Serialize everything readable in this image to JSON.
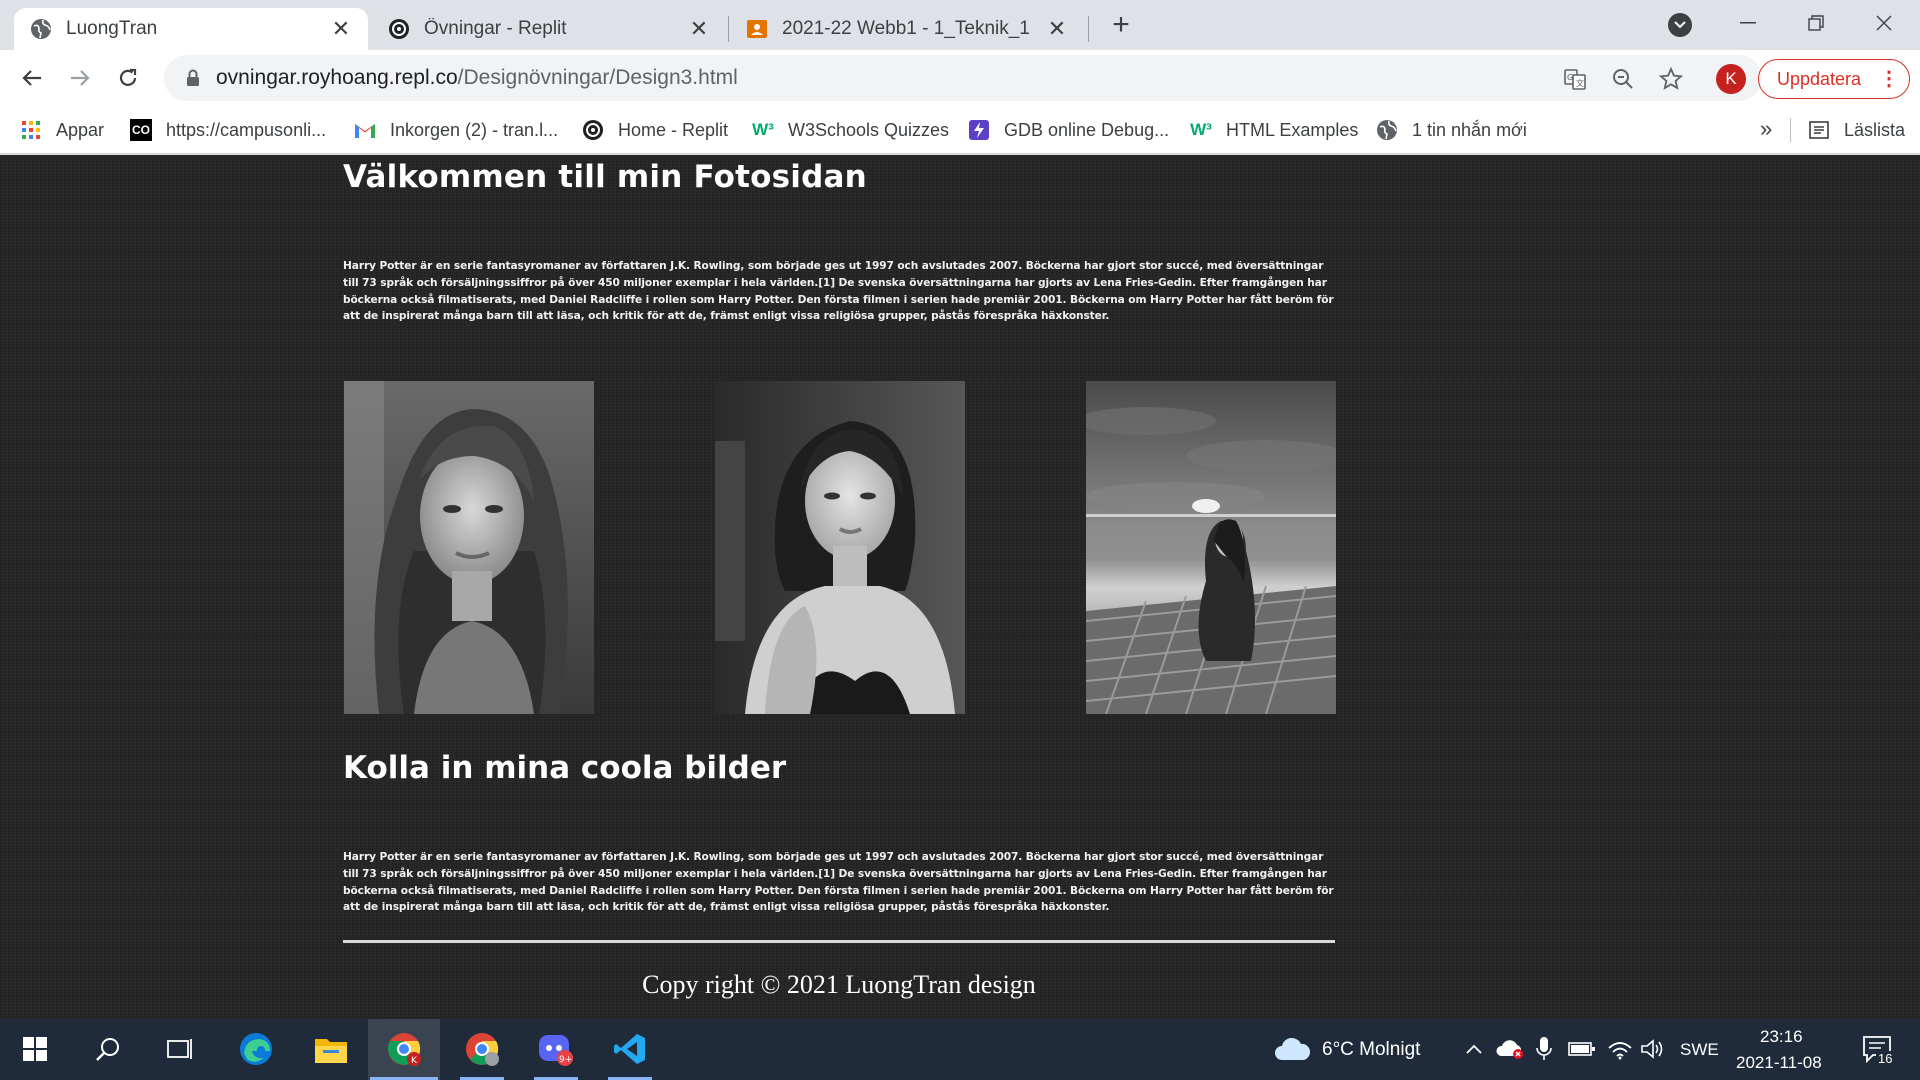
{
  "browser": {
    "tabs": [
      {
        "title": "LuongTran",
        "icon": "globe-icon",
        "active": true
      },
      {
        "title": "Övningar - Replit",
        "icon": "replit-icon",
        "active": false
      },
      {
        "title": "2021-22 Webb1 - 1_Teknik_1",
        "icon": "classroom-icon",
        "active": false
      }
    ],
    "address": {
      "host": "ovningar.royhoang.repl.co",
      "path": "/Designövningar/Design3.html"
    },
    "profile_initial": "K",
    "update_label": "Uppdatera",
    "bookmarks": [
      {
        "label": "Appar",
        "icon": "apps-grid-icon"
      },
      {
        "label": "https://campusonli...",
        "icon": "co-icon"
      },
      {
        "label": "Inkorgen (2) - tran.l...",
        "icon": "gmail-icon"
      },
      {
        "label": "Home - Replit",
        "icon": "replit-icon"
      },
      {
        "label": "W3Schools Quizzes",
        "icon": "w3schools-icon"
      },
      {
        "label": "GDB online Debug...",
        "icon": "gdb-icon"
      },
      {
        "label": "HTML Examples",
        "icon": "w3schools-icon"
      },
      {
        "label": "1 tin nhắn mới",
        "icon": "globe-icon"
      }
    ],
    "reading_list": "Läslista",
    "more": "»"
  },
  "page": {
    "title": "Välkommen till min Fotosidan",
    "paragraph": "Harry Potter är en serie fantasyromaner av författaren J.K. Rowling, som började ges ut 1997 och avslutades 2007. Böckerna har gjort stor succé, med översättningar till 73 språk och försäljningssiffror på över 450 miljoner exemplar i hela världen.[1] De svenska översättningarna har gjorts av Lena Fries-Gedin. Efter framgången har böckerna också filmatiserats, med Daniel Radcliffe i rollen som Harry Potter. Den första filmen i serien hade premiär 2001. Böckerna om Harry Potter har fått beröm för att de inspirerat många barn till att läsa, och kritik för att de, främst enligt vissa religiösa grupper, påstås förespråka häxkonster.",
    "section_title": "Kolla in mina coola bilder",
    "paragraph2": "Harry Potter är en serie fantasyromaner av författaren J.K. Rowling, som började ges ut 1997 och avslutades 2007. Böckerna har gjort stor succé, med översättningar till 73 språk och försäljningssiffror på över 450 miljoner exemplar i hela världen.[1] De svenska översättningarna har gjorts av Lena Fries-Gedin. Efter framgången har böckerna också filmatiserats, med Daniel Radcliffe i rollen som Harry Potter. Den första filmen i serien hade premiär 2001. Böckerna om Harry Potter har fått beröm för att de inspirerat många barn till att läsa, och kritik för att de, främst enligt vissa religiösa grupper, påstås förespråka häxkonster.",
    "footer": "Copy right © 2021 LuongTran design"
  },
  "taskbar": {
    "weather": "6°C  Molnigt",
    "language": "SWE",
    "time": "23:16",
    "date": "2021-11-08",
    "notifications": "16",
    "chat_badge": "9+"
  },
  "colors": {
    "page_bg": "#262626",
    "accent_red": "#d93025",
    "taskbar": "#1f2b3a"
  }
}
